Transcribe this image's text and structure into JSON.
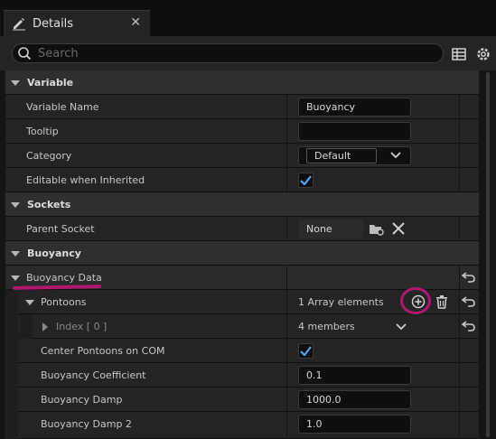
{
  "tab": {
    "title": "Details",
    "close": "✕"
  },
  "search": {
    "placeholder": "Search"
  },
  "sections": {
    "variable": "Variable",
    "sockets": "Sockets",
    "buoyancy": "Buoyancy"
  },
  "props": {
    "variable_name": {
      "label": "Variable Name",
      "value": "Buoyancy"
    },
    "tooltip": {
      "label": "Tooltip",
      "value": ""
    },
    "category": {
      "label": "Category",
      "value": "Default"
    },
    "editable": {
      "label": "Editable when Inherited",
      "checked": true
    },
    "parent_socket": {
      "label": "Parent Socket",
      "value": "None"
    },
    "buoyancy_data": {
      "label": "Buoyancy Data"
    },
    "pontoons": {
      "label": "Pontoons",
      "value": "1 Array elements"
    },
    "index": {
      "label": "Index [ 0 ]",
      "value": "4 members"
    },
    "center_pontoons": {
      "label": "Center Pontoons on COM",
      "checked": true
    },
    "coefficient": {
      "label": "Buoyancy Coefficient",
      "value": "0.1"
    },
    "damp": {
      "label": "Buoyancy Damp",
      "value": "1000.0"
    },
    "damp2": {
      "label": "Buoyancy Damp 2",
      "value": "1.0"
    }
  },
  "icons": {
    "tab": "pencil-icon",
    "search": "search-icon",
    "table": "table-view-icon",
    "settings": "gear-icon",
    "browse": "browse-socket-icon",
    "clear": "clear-icon",
    "add": "add-element-icon",
    "delete": "trash-icon",
    "reset": "reset-to-default-icon",
    "combo": "chevron-down-icon"
  },
  "colors": {
    "background": "#151515",
    "category_row": "#2f2f2f",
    "property_row": "#242424",
    "input": "#0f0f0f",
    "checkbox": "#4aa8ff",
    "annotation": "#b0186f"
  }
}
